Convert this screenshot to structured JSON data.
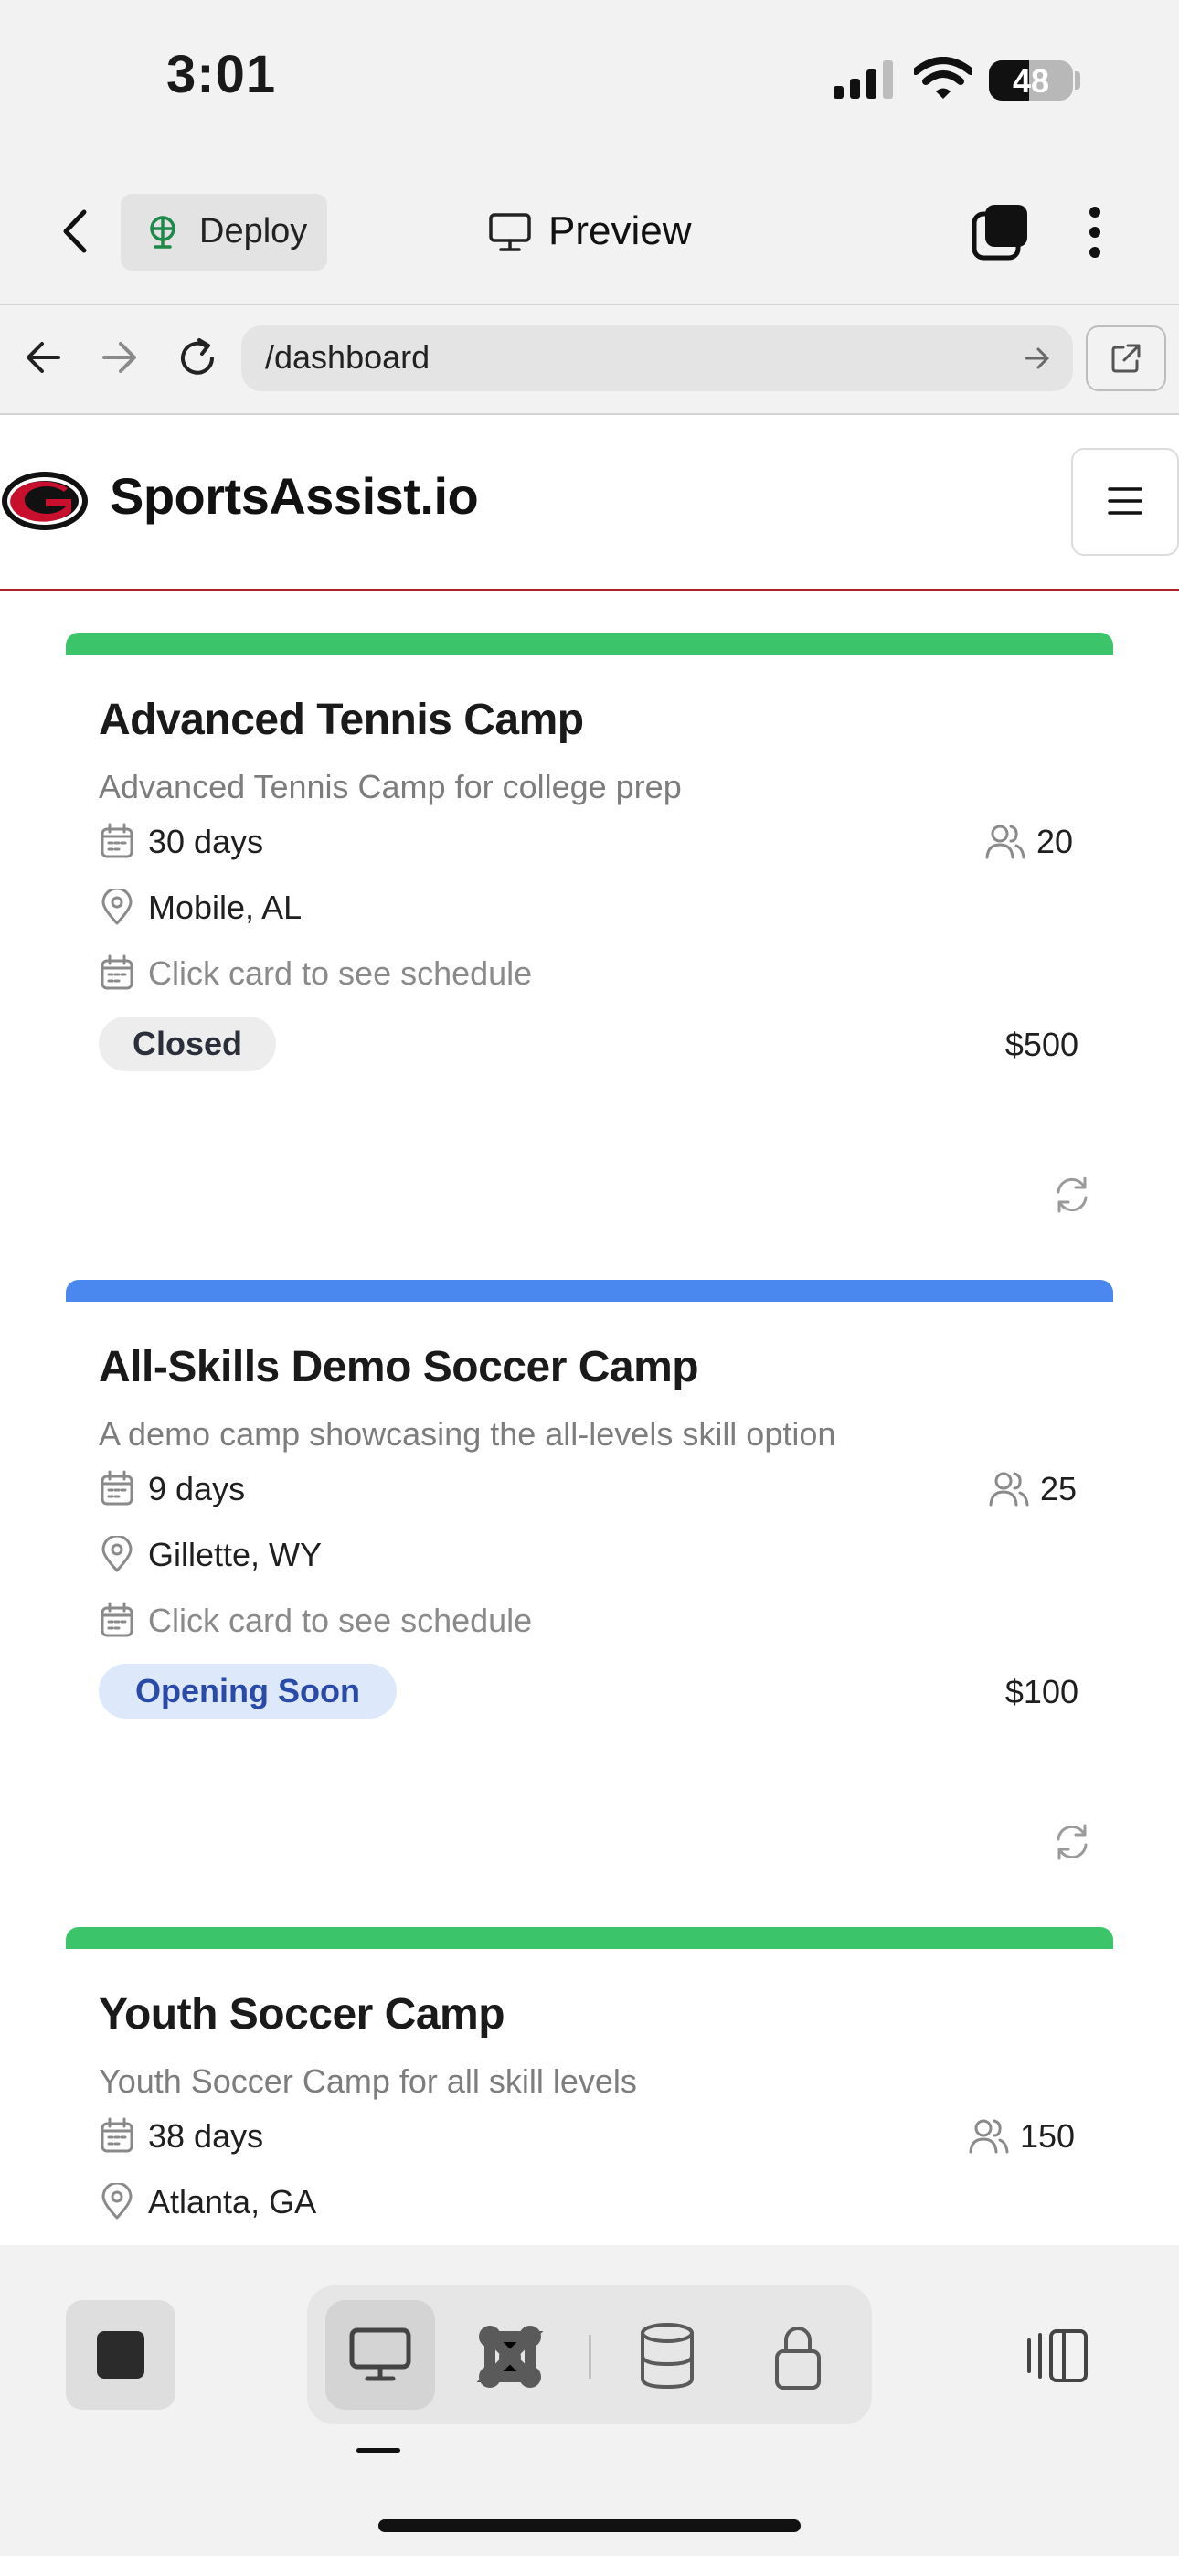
{
  "status_bar": {
    "time": "3:01",
    "battery": "48",
    "battery_percent": 48
  },
  "app_header": {
    "deploy_label": "Deploy",
    "preview_label": "Preview"
  },
  "browser": {
    "url": "/dashboard"
  },
  "site": {
    "brand": "SportsAssist.io"
  },
  "cards": [
    {
      "title": "Advanced Tennis Camp",
      "description": "Advanced Tennis Camp for college prep",
      "duration": "30 days",
      "capacity": "20",
      "location": "Mobile, AL",
      "schedule": "Click card to see schedule",
      "status": "Closed",
      "price": "$500",
      "accent_color": "#3cc46a",
      "badge_bg": "#ededed",
      "badge_fg": "#2a2f3a"
    },
    {
      "title": "All-Skills Demo Soccer Camp",
      "description": "A demo camp showcasing the all-levels skill option",
      "duration": "9 days",
      "capacity": "25",
      "location": "Gillette, WY",
      "schedule": "Click card to see schedule",
      "status": "Opening Soon",
      "price": "$100",
      "accent_color": "#4a88ef",
      "badge_bg": "#dde9fb",
      "badge_fg": "#2a4aa8"
    },
    {
      "title": "Youth Soccer Camp",
      "description": "Youth Soccer Camp for all skill levels",
      "duration": "38 days",
      "capacity": "150",
      "location": "Atlanta, GA",
      "accent_color": "#3cc46a"
    }
  ],
  "icons": {
    "back": "chevron-left-icon",
    "deploy": "globe-icon",
    "preview": "monitor-icon",
    "tabs": "tabs-icon",
    "more": "more-vertical-icon",
    "calendar": "calendar-icon",
    "location": "map-pin-icon",
    "users": "users-icon",
    "refresh": "refresh-icon",
    "menu": "hamburger-menu-icon"
  }
}
